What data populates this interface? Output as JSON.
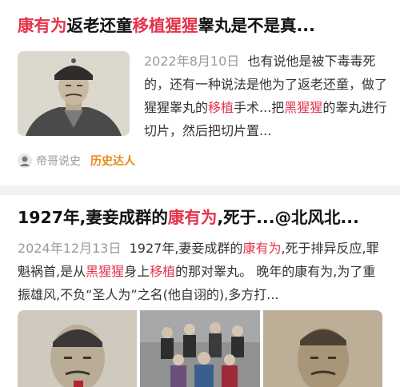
{
  "article1": {
    "title_hl1": "康有为",
    "title_part2": "返老还童",
    "title_hl2": "移植猩猩",
    "title_part3": "睾丸是不是真...",
    "date": "2022年8月10日",
    "body_part1": "也有说他是被下毒毒死的，还有一种说法是他为了返老还童，做了猩猩睾丸的",
    "body_hl1": "移植",
    "body_part2": "手术...把",
    "body_hl2": "黑猩猩",
    "body_part3": "的睾丸进行切片，然后把切片置...",
    "source_name": "帝哥说史",
    "source_badge": "历史达人"
  },
  "article2": {
    "title_part1": "1927年,妻妾成群的",
    "title_hl1": "康有为",
    "title_part2": ",死于...@北风北...",
    "date": "2024年12月13日",
    "body_part1": "1927年,妻妾成群的",
    "body_hl1": "康有为",
    "body_part2": ",死于排异反应,罪魁祸首,是从",
    "body_hl2": "黑猩猩",
    "body_part3": "身上",
    "body_hl3": "移植",
    "body_part4": "的那对睾丸。 晚年的康有为,为了重振雄风,不负“圣人为”之名(他自诩的),多方打..."
  },
  "colors": {
    "highlight": "#e5334b",
    "date": "#9a9a9a",
    "badge": "#e98a1a",
    "separator": "#f2f2f2"
  },
  "icons": {
    "source_avatar": "avatar-icon"
  }
}
